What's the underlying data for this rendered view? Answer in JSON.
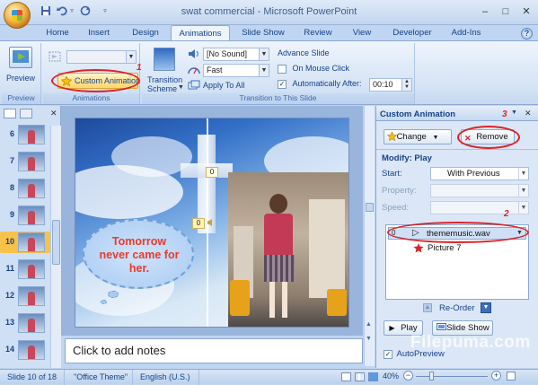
{
  "window": {
    "title": "swat commercial - Microsoft PowerPoint",
    "minimize_glyph": "–",
    "maximize_glyph": "□",
    "close_glyph": "✕"
  },
  "quick_access": {
    "save_icon": "save-icon",
    "undo_icon": "undo-icon",
    "redo_icon": "redo-icon",
    "customize_glyph": "▿"
  },
  "tabs": [
    "Home",
    "Insert",
    "Design",
    "Animations",
    "Slide Show",
    "Review",
    "View",
    "Developer",
    "Add-Ins"
  ],
  "active_tab": "Animations",
  "help_glyph": "?",
  "ribbon": {
    "preview": {
      "button_label": "Preview",
      "group_label": "Preview"
    },
    "animations": {
      "animate_value": "",
      "custom_animation_label": "Custom Animation",
      "group_label": "Animations",
      "marker": "1"
    },
    "transition": {
      "scheme_label_line1": "Transition",
      "scheme_label_line2": "Scheme",
      "sound_value": "[No Sound]",
      "speed_value": "Fast",
      "apply_to_all_label": "Apply To All",
      "group_label": "Transition to This Slide"
    },
    "advance": {
      "heading": "Advance Slide",
      "on_mouse_click_label": "On Mouse Click",
      "on_mouse_click_checked": false,
      "auto_after_label": "Automatically After:",
      "auto_after_checked": true,
      "auto_after_value": "00:10"
    }
  },
  "slides_panel": {
    "tab_icons": [
      "slides-tab-icon",
      "outline-tab-icon"
    ],
    "close_glyph": "✕",
    "thumbnails": [
      {
        "num": "6"
      },
      {
        "num": "7"
      },
      {
        "num": "8"
      },
      {
        "num": "9"
      },
      {
        "num": "10",
        "selected": true
      },
      {
        "num": "11"
      },
      {
        "num": "12"
      },
      {
        "num": "13"
      },
      {
        "num": "14"
      }
    ]
  },
  "slide": {
    "speech_text": "Tomorrow never came for her.",
    "tag_top": "0",
    "tag_side": "0"
  },
  "notes": {
    "placeholder": "Click to add notes"
  },
  "task_pane": {
    "title": "Custom Animation",
    "marker": "3",
    "change_label": "Change",
    "remove_label": "Remove",
    "modify_heading": "Modify: Play",
    "start_label": "Start:",
    "start_value": "With Previous",
    "property_label": "Property:",
    "speed_label": "Speed:",
    "list_marker": "2",
    "items": [
      {
        "index": "0",
        "name": "thememusic.wav",
        "selected": true
      },
      {
        "index": "",
        "name": "Picture 7",
        "selected": false
      }
    ],
    "reorder_label": "Re-Order",
    "play_label": "Play",
    "slide_show_label": "Slide Show",
    "autopreview_label": "AutoPreview",
    "autopreview_checked": true
  },
  "status": {
    "slide_info": "Slide 10 of 18",
    "theme": "\"Office Theme\"",
    "language": "English (U.S.)",
    "zoom": "40%",
    "watermark": "Filepuma.com"
  },
  "colors": {
    "annotation_red": "#d9232a",
    "ribbon_blue": "#15428b"
  }
}
